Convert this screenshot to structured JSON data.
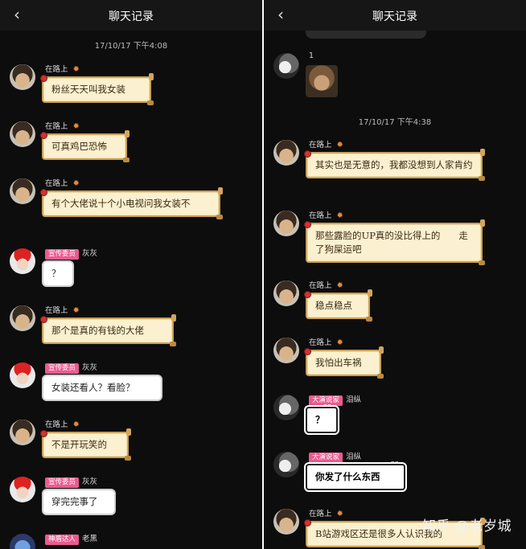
{
  "left": {
    "title": "聊天记录",
    "back_icon": "chevron-left-icon",
    "timestamp": "17/10/17 下午4:08",
    "messages": [
      {
        "name": "在路上",
        "badge": "",
        "text": "粉丝天天叫我女装",
        "style": "gold",
        "avatar": "boy",
        "sun": true
      },
      {
        "name": "在路上",
        "badge": "",
        "text": "可真鸡巴恐怖",
        "style": "gold",
        "avatar": "boy",
        "sun": true
      },
      {
        "name": "在路上",
        "badge": "",
        "text": "有个大佬说十个小电视问我女装不",
        "style": "gold",
        "avatar": "boy",
        "sun": true
      },
      {
        "name": "灰灰",
        "badge": "宣传委员",
        "text": "？",
        "style": "white",
        "avatar": "santa",
        "sun": false
      },
      {
        "name": "在路上",
        "badge": "",
        "text": "那个是真的有钱的大佬",
        "style": "gold",
        "avatar": "boy",
        "sun": true
      },
      {
        "name": "灰灰",
        "badge": "宣传委员",
        "text": "女装还看人？看脸？",
        "style": "white",
        "avatar": "santa",
        "sun": false
      },
      {
        "name": "在路上",
        "badge": "",
        "text": "不是开玩笑的",
        "style": "gold",
        "avatar": "boy",
        "sun": true
      },
      {
        "name": "灰灰",
        "badge": "宣传委员",
        "text": "穿完完事了",
        "style": "white",
        "avatar": "santa",
        "sun": false
      },
      {
        "name": "老黑",
        "badge": "神盾达人",
        "text": "",
        "style": "none",
        "avatar": "blue",
        "sun": false
      }
    ]
  },
  "right": {
    "title": "聊天记录",
    "back_icon": "chevron-left-icon",
    "timestamp": "17/10/17 下午4:38",
    "image_sender": {
      "name": "1",
      "avatar": "dog"
    },
    "messages": [
      {
        "name": "在路上",
        "badge": "",
        "text": "其实也是无意的，我都没想到人家肯约",
        "style": "gold",
        "avatar": "boy",
        "sun": true
      },
      {
        "name": "在路上",
        "badge": "",
        "text": "那些露脸的UP真的没比得上的　　走了狗屎运吧",
        "style": "gold",
        "avatar": "boy",
        "sun": true
      },
      {
        "name": "在路上",
        "badge": "",
        "text": "稳点稳点",
        "style": "gold",
        "avatar": "boy",
        "sun": true
      },
      {
        "name": "在路上",
        "badge": "",
        "text": "我怕出车祸",
        "style": "gold",
        "avatar": "boy",
        "sun": true
      },
      {
        "name": "泪纵",
        "badge": "大演说家",
        "text": "？",
        "style": "dark",
        "avatar": "dog",
        "sun": false
      },
      {
        "name": "泪纵",
        "badge": "大演说家",
        "text": "你发了什么东西",
        "style": "dark",
        "avatar": "dog",
        "sun": false
      },
      {
        "name": "在路上",
        "badge": "",
        "text": "B站游戏区还是很多人认识我的",
        "style": "gold",
        "avatar": "boy",
        "sun": true
      }
    ]
  },
  "watermark": "知乎 @老岁城"
}
